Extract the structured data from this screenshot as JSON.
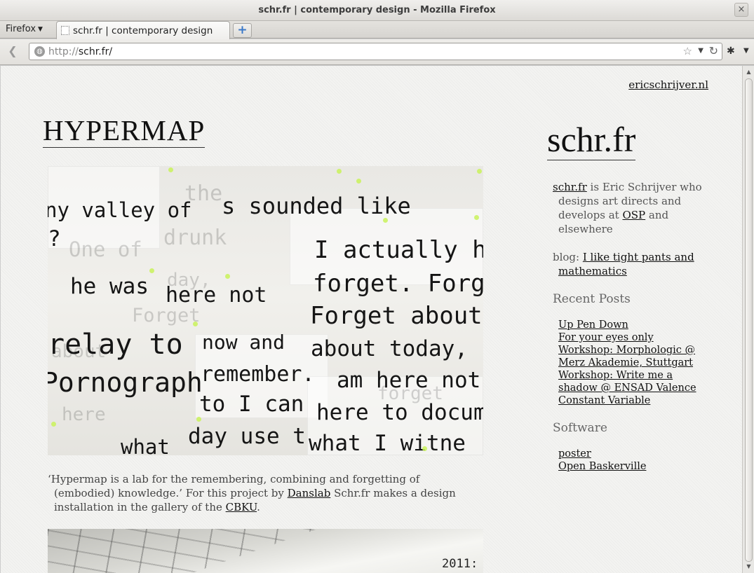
{
  "window": {
    "title": "schr.fr | contemporary design - Mozilla Firefox",
    "close_icon": "×"
  },
  "tabbar": {
    "menu_label": "Firefox",
    "tabs": [
      {
        "label": "schr.fr | contemporary design"
      }
    ],
    "new_tab_label": "+"
  },
  "navbar": {
    "url_protocol": "http://",
    "url_host": "schr.fr/"
  },
  "page": {
    "top_link": "ericschrijver.nl",
    "post_title": "HYPERMAP",
    "hero_lines": [
      "ny valley of",
      "s sounded like",
      "?",
      "I actually ho",
      "he was",
      "here not",
      "forget. Forge",
      "Forget about",
      "relay to",
      "now and",
      "about today,",
      "remember.",
      "Pornograph",
      "am here not",
      "to I can",
      "here to docum",
      "day use t",
      "what",
      "what I witne"
    ],
    "caption": {
      "part1": "‘Hypermap is a lab for the remembering, combining and forgetting of (embodied) knowledge.’ For this project by ",
      "link1": "Danslab",
      "part2": " Schr.fr makes a design installation in the gallery of the ",
      "link2": "CBKU",
      "part3": "."
    },
    "hero2_number": "2011:"
  },
  "sidebar": {
    "site_title": "schr.fr",
    "intro": {
      "link1": "schr.fr",
      "text1": " is Eric Schrijver who designs art directs and develops at ",
      "link2": "OSP",
      "text2": " and elsewhere"
    },
    "blog": {
      "label": "blog: ",
      "link": "I like tight pants and mathematics"
    },
    "recent_heading": "Recent Posts",
    "recent_posts": [
      "Up Pen Down",
      "For your eyes only",
      "Workshop: Morphologic @ Merz Akademie, Stuttgart",
      "Workshop: Write me a shadow @ ENSAD Valence",
      "Constant Variable"
    ],
    "software_heading": "Software",
    "software": [
      "poster",
      "Open Baskerville"
    ]
  }
}
